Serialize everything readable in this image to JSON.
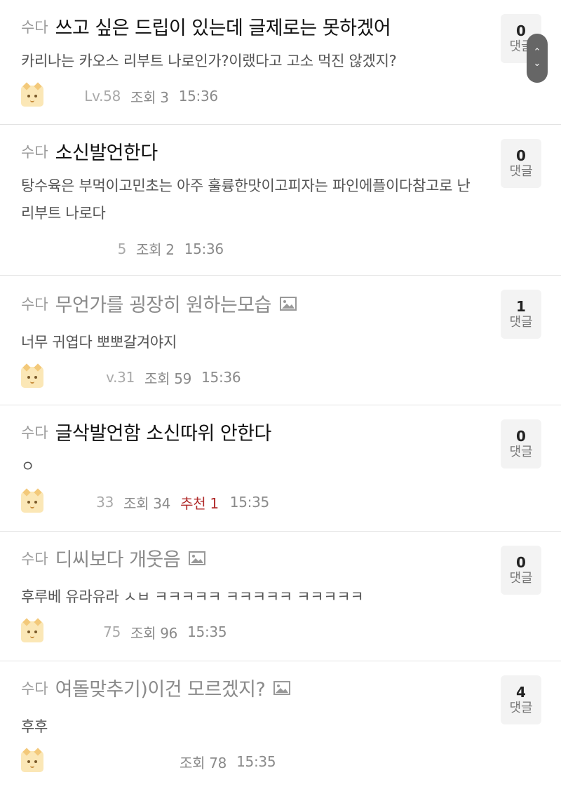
{
  "posts": [
    {
      "category": "수다",
      "title": "쓰고 싶은 드립이 있는데 글제로는 못하겠어",
      "preview": "카리나는 카오스 리부트 나로인가?이랬다고 고소 먹진 않겠지?",
      "nick": "Lv.58",
      "views": "조회 3",
      "time": "15:36",
      "comment_count": "0",
      "comment_label": "댓글"
    },
    {
      "category": "수다",
      "title": "소신발언한다",
      "preview": "탕수육은 부먹이고민초는 아주 훌륭한맛이고피자는 파인에플이다참고로 난 리부트 나로다",
      "nick": "5",
      "views": "조회 2",
      "time": "15:36",
      "comment_count": "0",
      "comment_label": "댓글"
    },
    {
      "category": "수다",
      "title": "무언가를 굉장히 원하는모습",
      "preview": "너무 귀엽다 뽀뽀갈겨야지",
      "nick": "v.31",
      "views": "조회 59",
      "time": "15:36",
      "comment_count": "1",
      "comment_label": "댓글"
    },
    {
      "category": "수다",
      "title": "글삭발언함 소신따위 안한다",
      "preview": "ㅇ",
      "nick": "33",
      "views": "조회 34",
      "recommend": "추천 1",
      "time": "15:35",
      "comment_count": "0",
      "comment_label": "댓글"
    },
    {
      "category": "수다",
      "title": "디씨보다 개웃음",
      "preview": "후루베 유라유라 ㅅㅂ ㅋㅋㅋㅋㅋ ㅋㅋㅋㅋㅋ ㅋㅋㅋㅋㅋ",
      "nick": "75",
      "views": "조회 96",
      "time": "15:35",
      "comment_count": "0",
      "comment_label": "댓글"
    },
    {
      "category": "수다",
      "title": "여돌맞추기)이건 모르겠지?",
      "preview": "후후",
      "nick": "",
      "views": "조회 78",
      "time": "15:35",
      "comment_count": "4",
      "comment_label": "댓글"
    }
  ],
  "scroll": {
    "up": "⌃",
    "down": "⌄"
  }
}
